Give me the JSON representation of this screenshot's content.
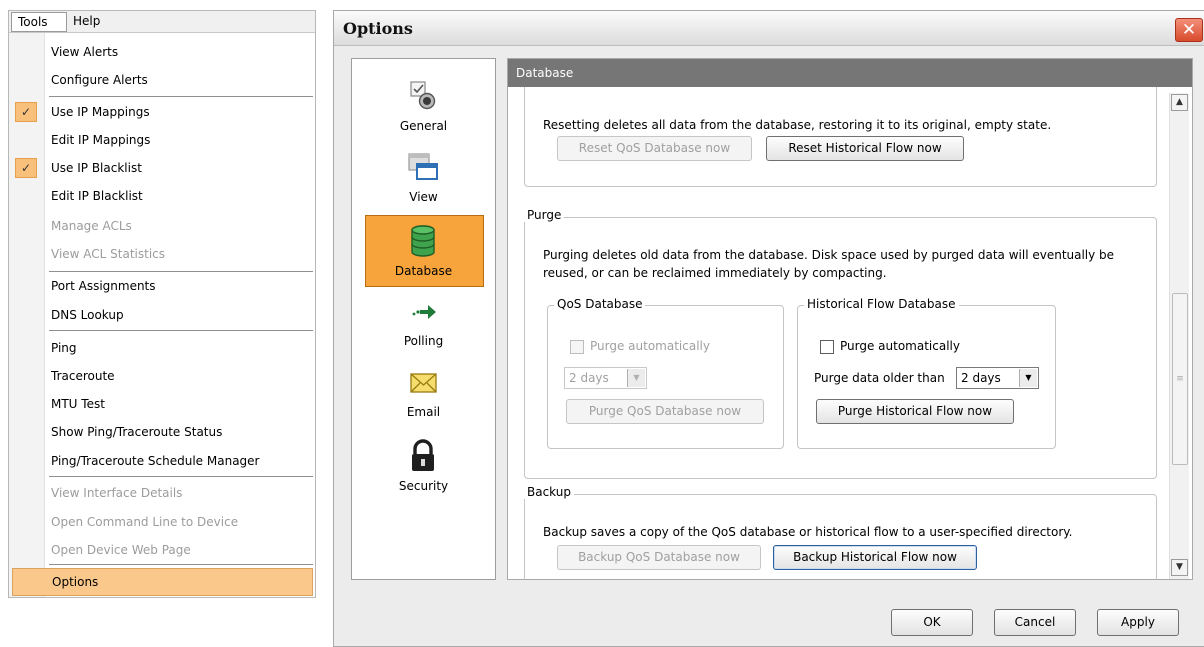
{
  "menu": {
    "bar": [
      "Tools",
      "Help"
    ],
    "items": [
      {
        "label": "View Alerts",
        "enabled": true,
        "checked": false
      },
      {
        "label": "Configure Alerts",
        "enabled": true,
        "checked": false
      },
      {
        "label": "Use IP Mappings",
        "enabled": true,
        "checked": true
      },
      {
        "label": "Edit IP Mappings",
        "enabled": true,
        "checked": false
      },
      {
        "label": "Use IP Blacklist",
        "enabled": true,
        "checked": true
      },
      {
        "label": "Edit IP Blacklist",
        "enabled": true,
        "checked": false
      },
      {
        "label": "Manage ACLs",
        "enabled": false,
        "checked": false
      },
      {
        "label": "View ACL Statistics",
        "enabled": false,
        "checked": false
      },
      {
        "label": "Port Assignments",
        "enabled": true,
        "checked": false
      },
      {
        "label": "DNS Lookup",
        "enabled": true,
        "checked": false
      },
      {
        "label": "Ping",
        "enabled": true,
        "checked": false
      },
      {
        "label": "Traceroute",
        "enabled": true,
        "checked": false
      },
      {
        "label": "MTU Test",
        "enabled": true,
        "checked": false
      },
      {
        "label": "Show Ping/Traceroute Status",
        "enabled": true,
        "checked": false
      },
      {
        "label": "Ping/Traceroute Schedule Manager",
        "enabled": true,
        "checked": false
      },
      {
        "label": "View Interface Details",
        "enabled": false,
        "checked": false
      },
      {
        "label": "Open Command Line to Device",
        "enabled": false,
        "checked": false
      },
      {
        "label": "Open Device Web Page",
        "enabled": false,
        "checked": false
      },
      {
        "label": "Options",
        "enabled": true,
        "checked": false,
        "selected": true
      }
    ],
    "check_glyph": "✓"
  },
  "dialog": {
    "title": "Options",
    "close_glyph": "✕",
    "nav": [
      {
        "label": "General",
        "icon": "general-settings-icon"
      },
      {
        "label": "View",
        "icon": "window-view-icon"
      },
      {
        "label": "Database",
        "icon": "database-icon",
        "selected": true
      },
      {
        "label": "Polling",
        "icon": "polling-arrow-icon"
      },
      {
        "label": "Email",
        "icon": "envelope-icon"
      },
      {
        "label": "Security",
        "icon": "padlock-icon"
      }
    ],
    "header": "Database",
    "reset": {
      "text": "Resetting deletes all data from the database, restoring it to its original, empty state.",
      "qos_button": "Reset QoS Database now",
      "flow_button": "Reset Historical Flow now"
    },
    "purge": {
      "title": "Purge",
      "text_line1": "Purging deletes old data from the database.  Disk space used by purged data will eventually be",
      "text_line2": "reused, or can be reclaimed immediately by compacting.",
      "qos": {
        "title": "QoS Database",
        "auto_label": "Purge automatically",
        "days": "2 days",
        "button": "Purge QoS Database now"
      },
      "flow": {
        "title": "Historical Flow Database",
        "auto_label": "Purge automatically",
        "older_label": "Purge data older than",
        "days": "2 days",
        "button": "Purge Historical Flow now"
      }
    },
    "backup": {
      "title": "Backup",
      "text": "Backup saves a copy of the QoS database or historical flow to a user-specified directory.",
      "qos_button": "Backup QoS Database now",
      "flow_button": "Backup Historical Flow now"
    },
    "buttons": {
      "ok": "OK",
      "cancel": "Cancel",
      "apply": "Apply"
    },
    "scroll_glyphs": {
      "up": "▲",
      "down": "▼",
      "grip": "≡",
      "dropdown": "▼"
    },
    "colors": {
      "selected_nav": "#f8a43c",
      "header_bg": "#767676",
      "menu_highlight": "#f9c88a"
    }
  }
}
